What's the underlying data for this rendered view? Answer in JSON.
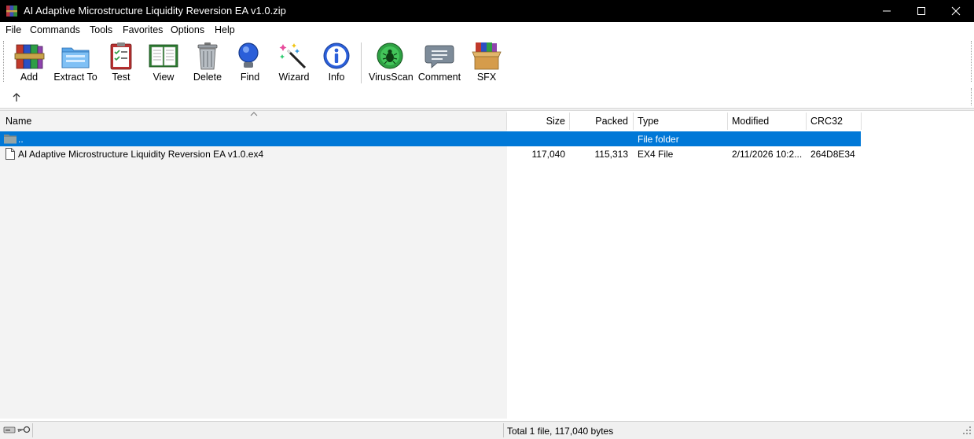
{
  "window": {
    "title": "AI Adaptive Microstructure Liquidity Reversion EA v1.0.zip"
  },
  "menu": [
    "File",
    "Commands",
    "Tools",
    "Favorites",
    "Options",
    "Help"
  ],
  "toolbar": {
    "add": "Add",
    "extract": "Extract To",
    "test": "Test",
    "view": "View",
    "delete": "Delete",
    "find": "Find",
    "wizard": "Wizard",
    "info": "Info",
    "virusscan": "VirusScan",
    "comment": "Comment",
    "sfx": "SFX"
  },
  "columns": {
    "name": "Name",
    "size": "Size",
    "packed": "Packed",
    "type": "Type",
    "modified": "Modified",
    "crc": "CRC32"
  },
  "rows": [
    {
      "name": "..",
      "size": "",
      "packed": "",
      "type": "File folder",
      "modified": "",
      "crc": "",
      "selected": true
    },
    {
      "name": "AI Adaptive Microstructure Liquidity Reversion EA v1.0.ex4",
      "size": "117,040",
      "packed": "115,313",
      "type": "EX4 File",
      "modified": "2/11/2026 10:2...",
      "crc": "264D8E34",
      "selected": false
    }
  ],
  "status": {
    "text": "Total 1 file, 117,040 bytes"
  },
  "colors": {
    "selection": "#0078d7",
    "titlebar": "#000000"
  }
}
